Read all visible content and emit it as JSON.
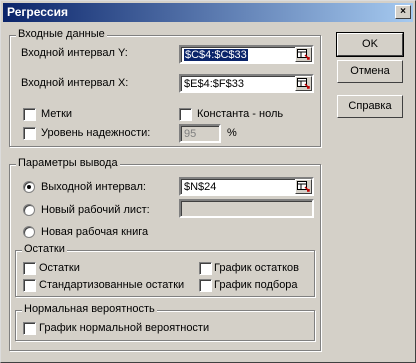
{
  "window": {
    "title": "Регрессия",
    "close_glyph": "×"
  },
  "input_group": {
    "title": "Входные данные",
    "y_label": "Входной интервал Y:",
    "y_value": "$C$4:$C$33",
    "x_label": "Входной интервал X:",
    "x_value": "$E$4:$F$33",
    "labels_check": "Метки",
    "constant_zero_check": "Константа - ноль",
    "confidence_check": "Уровень надежности:",
    "confidence_value": "95",
    "percent": "%"
  },
  "output_group": {
    "title": "Параметры вывода",
    "output_range_radio": "Выходной интервал:",
    "output_range_value": "$N$24",
    "new_sheet_radio": "Новый рабочий лист:",
    "new_sheet_value": "",
    "new_book_radio": "Новая рабочая книга"
  },
  "residuals_group": {
    "title": "Остатки",
    "residuals_check": "Остатки",
    "std_residuals_check": "Стандартизованные остатки",
    "residual_plot_check": "График остатков",
    "fit_plot_check": "График подбора"
  },
  "normal_group": {
    "title": "Нормальная вероятность",
    "normal_plot_check": "График нормальной вероятности"
  },
  "buttons": {
    "ok": "OK",
    "cancel": "Отмена",
    "help": "Справка"
  }
}
